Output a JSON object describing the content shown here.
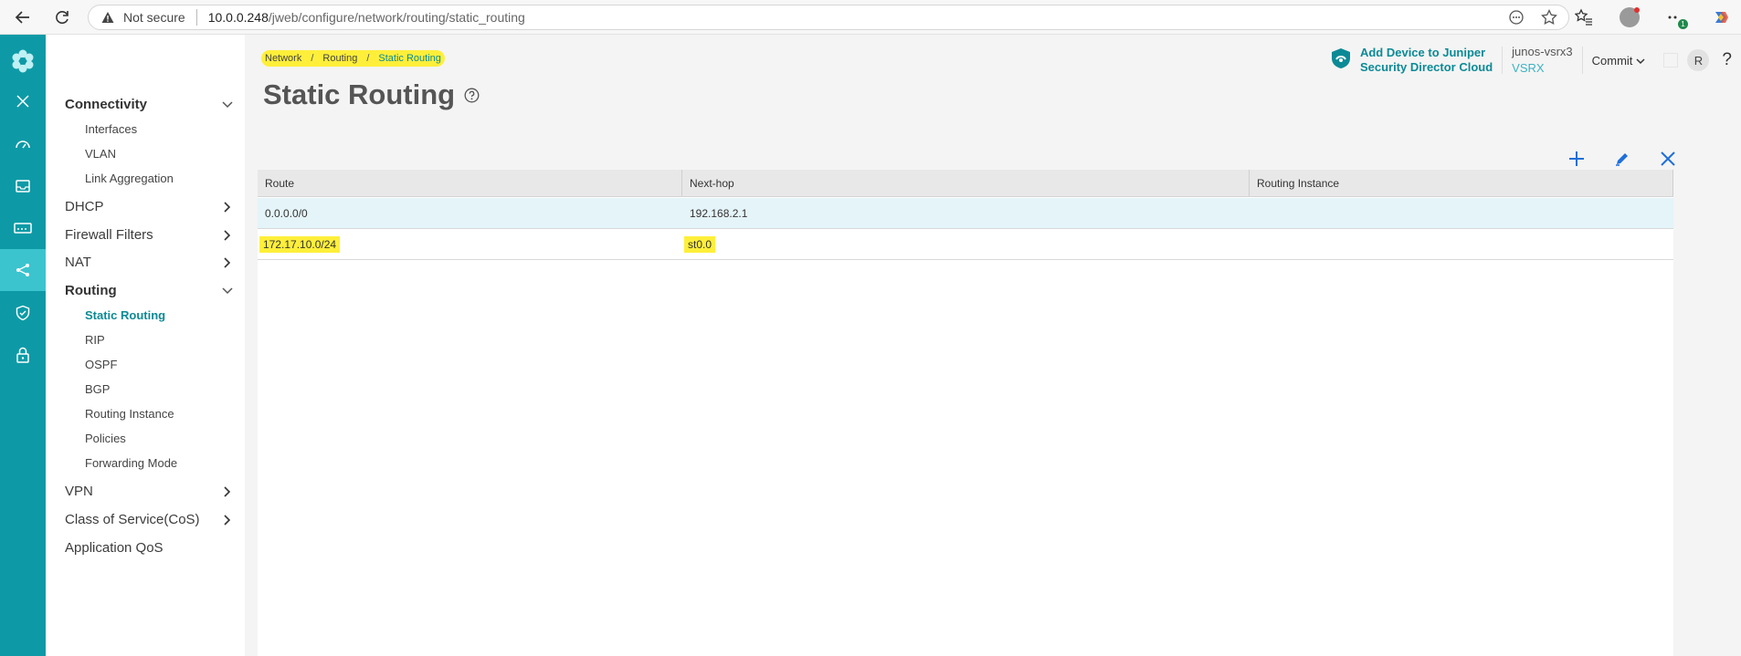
{
  "browser": {
    "not_secure": "Not secure",
    "url_host": "10.0.0.248",
    "url_path": "/jweb/configure/network/routing/static_routing",
    "ext_badge": "1"
  },
  "header": {
    "sd_line1": "Add Device to Juniper",
    "sd_line2": "Security Director Cloud",
    "device_name": "junos-vsrx3",
    "device_model": "VSRX",
    "commit_label": "Commit",
    "user_initial": "R",
    "help": "?"
  },
  "breadcrumb": {
    "items": [
      "Network",
      "Routing"
    ],
    "current": "Static Routing",
    "separator": "/"
  },
  "page": {
    "title": "Static Routing"
  },
  "sidebar": {
    "connectivity": "Connectivity",
    "interfaces": "Interfaces",
    "vlan": "VLAN",
    "link_aggregation": "Link Aggregation",
    "dhcp": "DHCP",
    "firewall_filters": "Firewall Filters",
    "nat": "NAT",
    "routing": "Routing",
    "static_routing": "Static Routing",
    "rip": "RIP",
    "ospf": "OSPF",
    "bgp": "BGP",
    "routing_instance": "Routing Instance",
    "policies": "Policies",
    "forwarding_mode": "Forwarding Mode",
    "vpn": "VPN",
    "cos": "Class of Service(CoS)",
    "app_qos": "Application QoS"
  },
  "table": {
    "columns": [
      "Route",
      "Next-hop",
      "Routing Instance"
    ],
    "rows": [
      {
        "route": "0.0.0.0/0",
        "next_hop": "192.168.2.1",
        "instance": ""
      },
      {
        "route": "172.17.10.0/24",
        "next_hop": "st0.0",
        "instance": ""
      }
    ]
  },
  "colors": {
    "rail": "#0d9aa6",
    "accent": "#0b8a96",
    "highlight": "#ffef3a"
  }
}
